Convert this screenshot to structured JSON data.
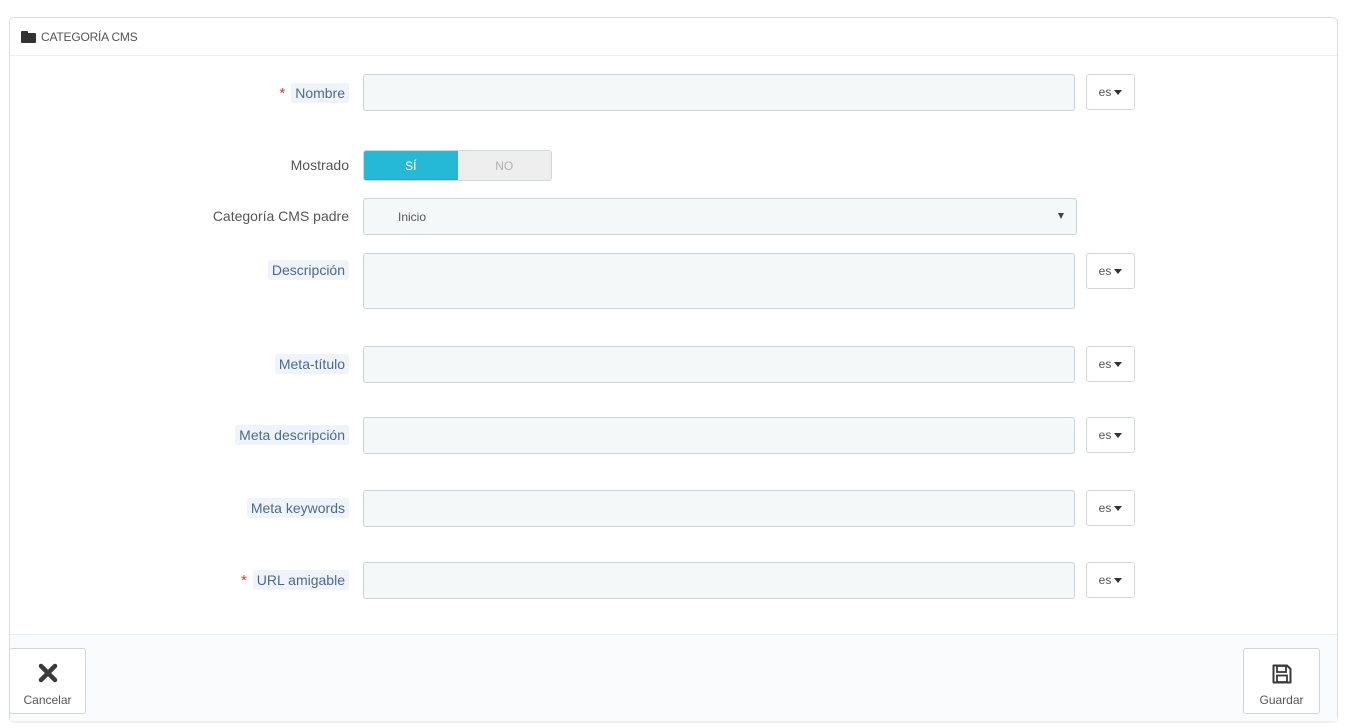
{
  "panel": {
    "title": "CATEGORÍA CMS",
    "icon": "folder-icon"
  },
  "form": {
    "nombre": {
      "label": "Nombre",
      "required": true,
      "value": "",
      "lang": "es"
    },
    "mostrado": {
      "label": "Mostrado",
      "on_label": "SÍ",
      "off_label": "NO",
      "selected": "SÍ"
    },
    "categoria_padre": {
      "label": "Categoría CMS padre",
      "selected": "Inicio"
    },
    "descripcion": {
      "label": "Descripción",
      "value": "",
      "lang": "es"
    },
    "meta_titulo": {
      "label": "Meta-título",
      "value": "",
      "lang": "es"
    },
    "meta_descripcion": {
      "label": "Meta descripción",
      "value": "",
      "lang": "es"
    },
    "meta_keywords": {
      "label": "Meta keywords",
      "value": "",
      "lang": "es"
    },
    "url_amigable": {
      "label": "URL amigable",
      "required": true,
      "value": "",
      "lang": "es"
    },
    "required_marker": "*"
  },
  "footer": {
    "cancel_label": "Cancelar",
    "save_label": "Guardar"
  },
  "colors": {
    "accent": "#25b9d7",
    "required": "#e0392c",
    "hint_label": "#4d6a8c",
    "input_bg": "#f5f8f9"
  }
}
